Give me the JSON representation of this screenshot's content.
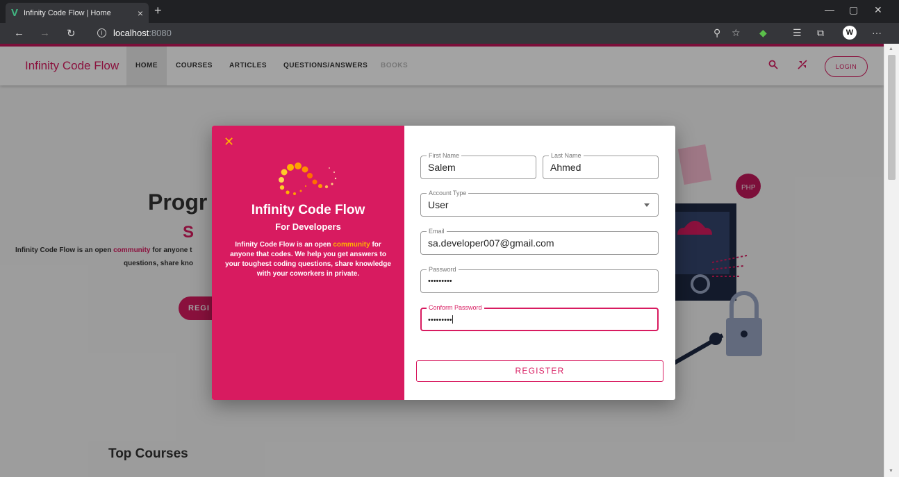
{
  "browser": {
    "tab_title": "Infinity Code Flow | Home",
    "tab_close": "×",
    "new_tab": "+",
    "url_host": "localhost",
    "url_port": ":8080"
  },
  "appbar": {
    "logo": "Infinity Code Flow",
    "nav": [
      "HOME",
      "COURSES",
      "ARTICLES",
      "QUESTIONS/ANSWERS",
      "BOOKS"
    ],
    "login": "LOGIN"
  },
  "hero": {
    "title": "Progr",
    "subtitle": "S",
    "text1_a": "Infinity Code Flow is an open ",
    "text1_link": "community",
    "text1_b": " for anyone t",
    "text2": "questions, share kno",
    "button": "REGI"
  },
  "section": {
    "top_courses": "Top Courses"
  },
  "dialog": {
    "close": "✕",
    "brand": "Infinity Code Flow",
    "tagline": "For Developers",
    "desc_a": "Infinity Code Flow is an open ",
    "desc_link": "community",
    "desc_b": " for anyone that codes. We help you get answers to your toughest coding questions, share knowledge with your coworkers in private.",
    "form": {
      "first_name_label": "First Name",
      "first_name_value": "Salem",
      "last_name_label": "Last Name",
      "last_name_value": "Ahmed",
      "account_type_label": "Account Type",
      "account_type_value": "User",
      "email_label": "Email",
      "email_value": "sa.developer007@gmail.com",
      "password_label": "Password",
      "password_value": "•••••••••",
      "confirm_label": "Conform Password",
      "confirm_value": "•••••••••"
    },
    "register_button": "REGISTER"
  },
  "colors": {
    "brand_pink": "#d81b60",
    "accent_orange": "#ffb300"
  }
}
